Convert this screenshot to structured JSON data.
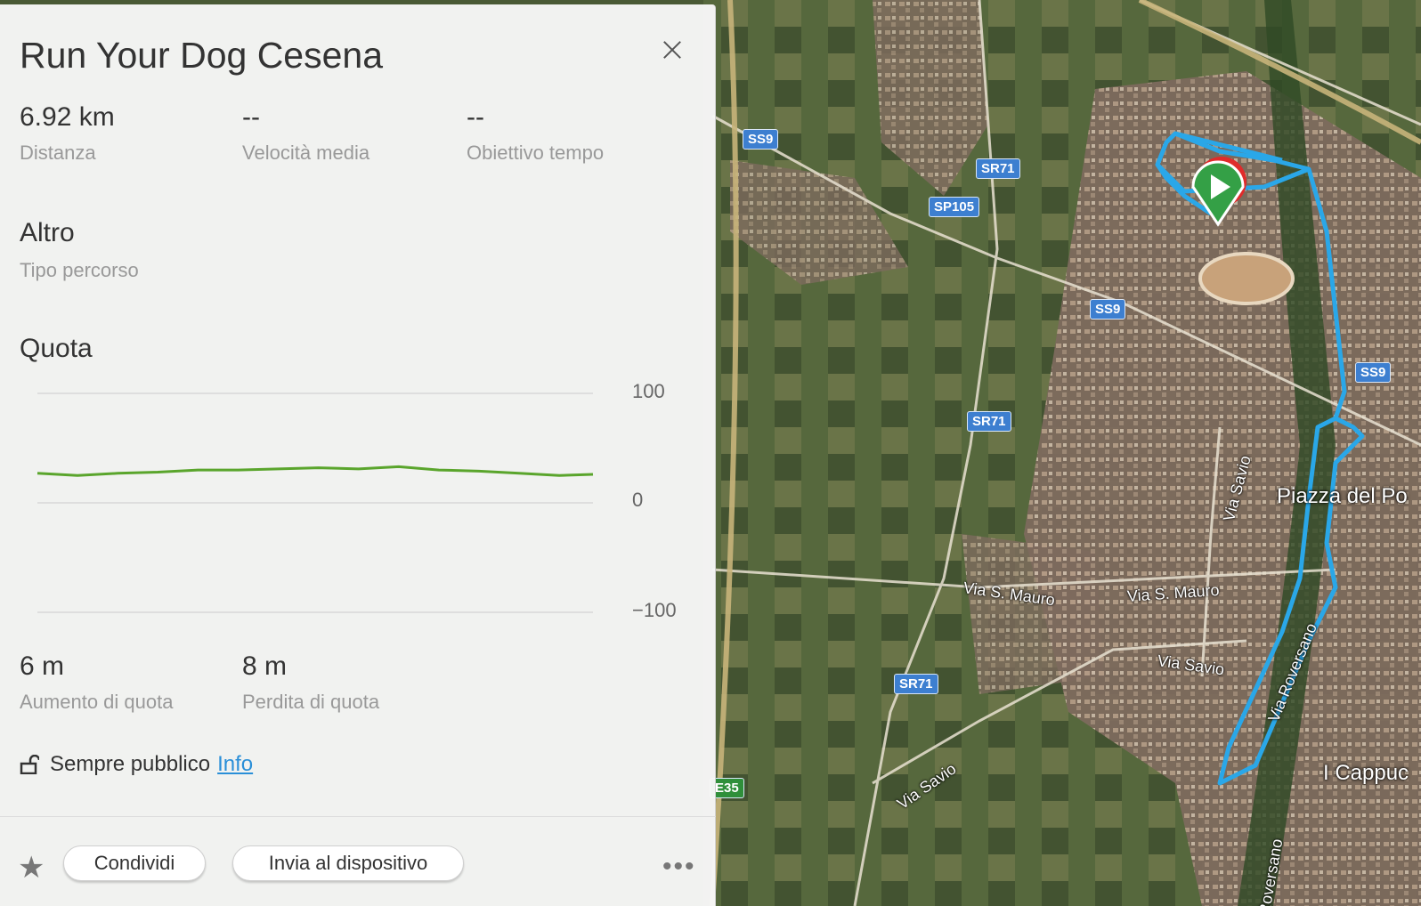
{
  "route": {
    "title": "Run Your Dog Cesena",
    "close_icon": "close-icon"
  },
  "stats": [
    {
      "value": "6.92 km",
      "label": "Distanza"
    },
    {
      "value": "--",
      "label": "Velocità media"
    },
    {
      "value": "--",
      "label": "Obiettivo tempo"
    }
  ],
  "route_type": {
    "value": "Altro",
    "label": "Tipo percorso"
  },
  "elevation": {
    "heading": "Quota",
    "axis_labels": [
      "100",
      "0",
      "−100"
    ],
    "gain": {
      "value": "6 m",
      "label": "Aumento di quota"
    },
    "loss": {
      "value": "8 m",
      "label": "Perdita di quota"
    }
  },
  "chart_data": {
    "type": "line",
    "title": "",
    "xlabel": "",
    "ylabel": "",
    "ylim": [
      -100,
      100
    ],
    "x": [
      0,
      0.5,
      1,
      1.5,
      2,
      2.5,
      3,
      3.5,
      4,
      4.5,
      5,
      5.5,
      6,
      6.5,
      6.92
    ],
    "series": [
      {
        "values": [
          27,
          25,
          27,
          28,
          30,
          30,
          31,
          32,
          31,
          33,
          30,
          29,
          27,
          25,
          26
        ]
      }
    ]
  },
  "privacy": {
    "label": "Sempre pubblico",
    "link": "Info"
  },
  "actions": {
    "favorite_icon": "star-icon",
    "share": "Condividi",
    "send": "Invia al dispositivo",
    "more_icon": "more-icon"
  },
  "map": {
    "route_color": "#2aa7e8",
    "start_marker_color": "#34a046",
    "shields": [
      {
        "id": "ss9-a",
        "text": "SS9",
        "type": "blue"
      },
      {
        "id": "sr71-a",
        "text": "SR71",
        "type": "blue"
      },
      {
        "id": "sp105",
        "text": "SP105",
        "type": "blue"
      },
      {
        "id": "ss9-b",
        "text": "SS9",
        "type": "blue"
      },
      {
        "id": "ss9-c",
        "text": "SS9",
        "type": "blue"
      },
      {
        "id": "sr71-b",
        "text": "SR71",
        "type": "blue"
      },
      {
        "id": "sr71-c",
        "text": "SR71",
        "type": "blue"
      },
      {
        "id": "e35",
        "text": "E35",
        "type": "green"
      }
    ],
    "streets": {
      "via_s_mauro_1": "Via S. Mauro",
      "via_s_mauro_2": "Via S. Mauro",
      "via_savio_1": "Via Savio",
      "via_savio_2": "Via Savio",
      "via_savio_3": "Via Savio",
      "via_roversano_1": "Via Roversano",
      "via_roversano_2": "Roversano"
    },
    "places": {
      "piazza": "Piazza del Po",
      "cappuccini": "I Cappuc"
    }
  }
}
